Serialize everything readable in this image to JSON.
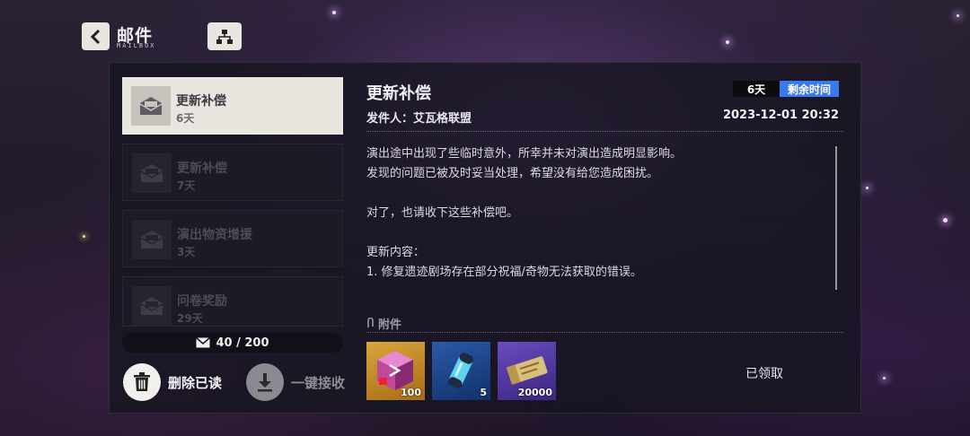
{
  "header": {
    "title": "邮件",
    "subtitle": "MAILBOX"
  },
  "mail_list": [
    {
      "name": "更新补偿",
      "days": "6天",
      "active": true
    },
    {
      "name": "更新补偿",
      "days": "7天",
      "active": false
    },
    {
      "name": "演出物资增援",
      "days": "3天",
      "active": false
    },
    {
      "name": "问卷奖励",
      "days": "29天",
      "active": false
    }
  ],
  "counter": "40 / 200",
  "actions": {
    "delete_read": "删除已读",
    "receive_all": "一键接收"
  },
  "detail": {
    "title": "更新补偿",
    "sender": "发件人：艾瓦格联盟",
    "days_badge": "6天",
    "remaining_badge": "剩余时间",
    "date": "2023-12-01 20:32",
    "body": [
      "演出途中出现了些临时意外，所幸并未对演出造成明显影响。",
      "发现的问题已被及时妥当处理，希望没有给您造成困扰。",
      "对了，也请收下这些补偿吧。",
      "更新内容：",
      "1. 修复遗迹剧场存在部分祝福/奇物无法获取的错误。"
    ],
    "attachment_label": "附件",
    "rewards": [
      {
        "qty": "100",
        "icon": "pink-cube-icon"
      },
      {
        "qty": "5",
        "icon": "capsule-icon"
      },
      {
        "qty": "20000",
        "icon": "ticket-icon"
      }
    ],
    "claimed_label": "已领取"
  },
  "colors": {
    "accent_blue": "#3a78f0",
    "active_item": "#e9e6df"
  }
}
